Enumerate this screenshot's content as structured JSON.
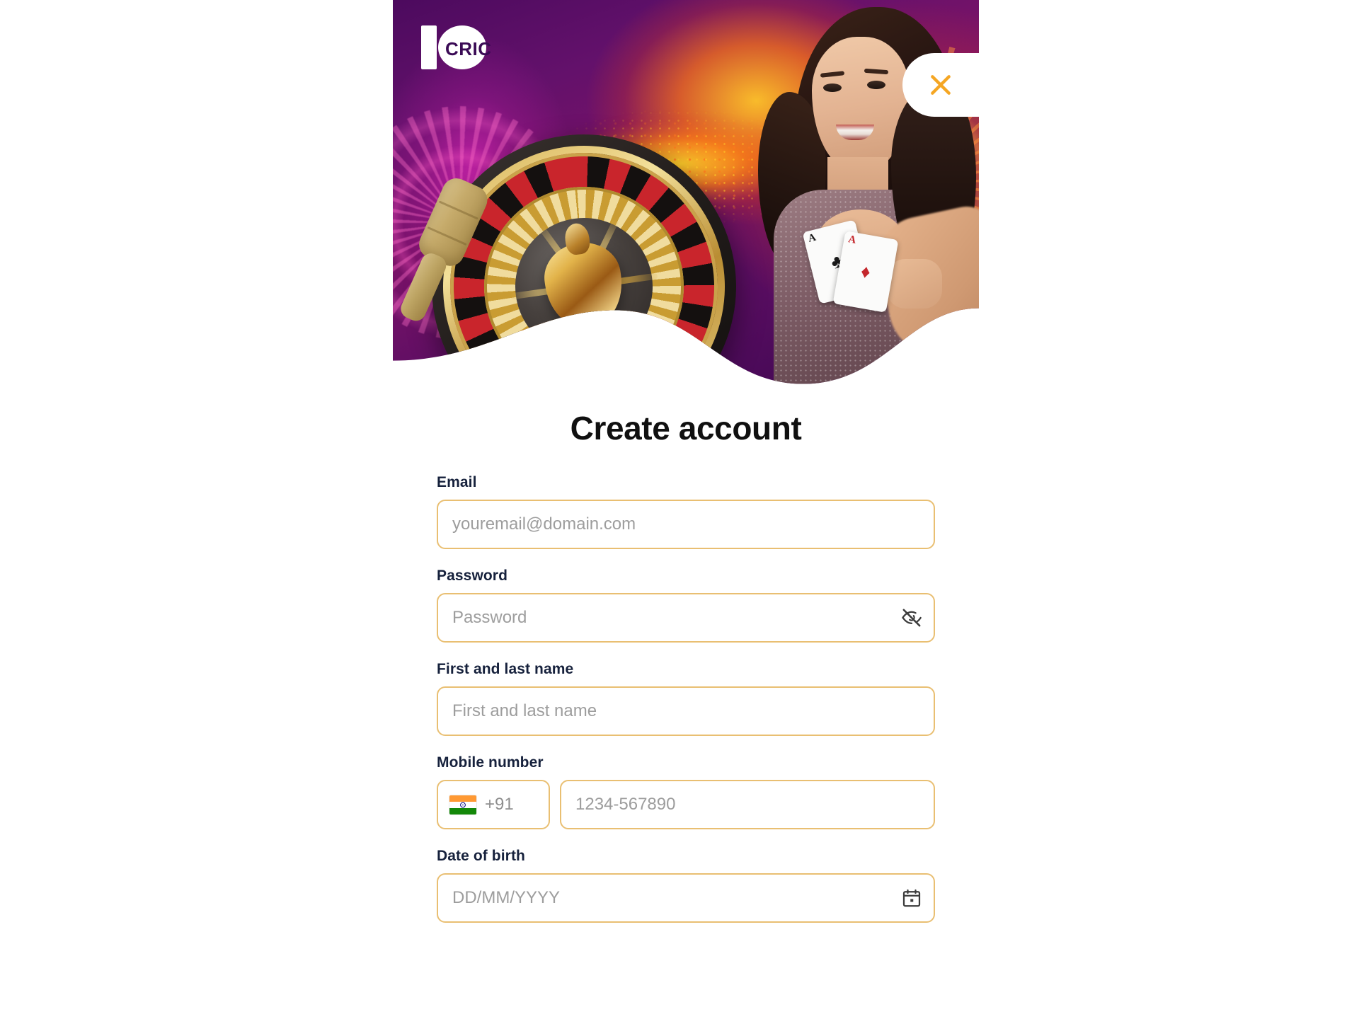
{
  "brand": {
    "logo_text_number": "10",
    "logo_text_word": "CRIC",
    "accent_border": "#E9BF72",
    "accent_close": "#F5A623",
    "hero_purple": "#4C0A5E"
  },
  "hero": {
    "close_label": "Close",
    "close_icon": "close-icon"
  },
  "form": {
    "title": "Create account",
    "fields": {
      "email": {
        "label": "Email",
        "placeholder": "youremail@domain.com",
        "value": ""
      },
      "password": {
        "label": "Password",
        "placeholder": "Password",
        "value": "",
        "toggle_icon": "eye-off-icon"
      },
      "full_name": {
        "label": "First and last name",
        "placeholder": "First and last name",
        "value": ""
      },
      "mobile": {
        "label": "Mobile number",
        "country_flag": "india-flag-icon",
        "country_code": "+91",
        "placeholder": "1234-567890",
        "value": ""
      },
      "dob": {
        "label": "Date of birth",
        "placeholder": "DD/MM/YYYY",
        "value": "",
        "picker_icon": "calendar-icon"
      }
    }
  }
}
